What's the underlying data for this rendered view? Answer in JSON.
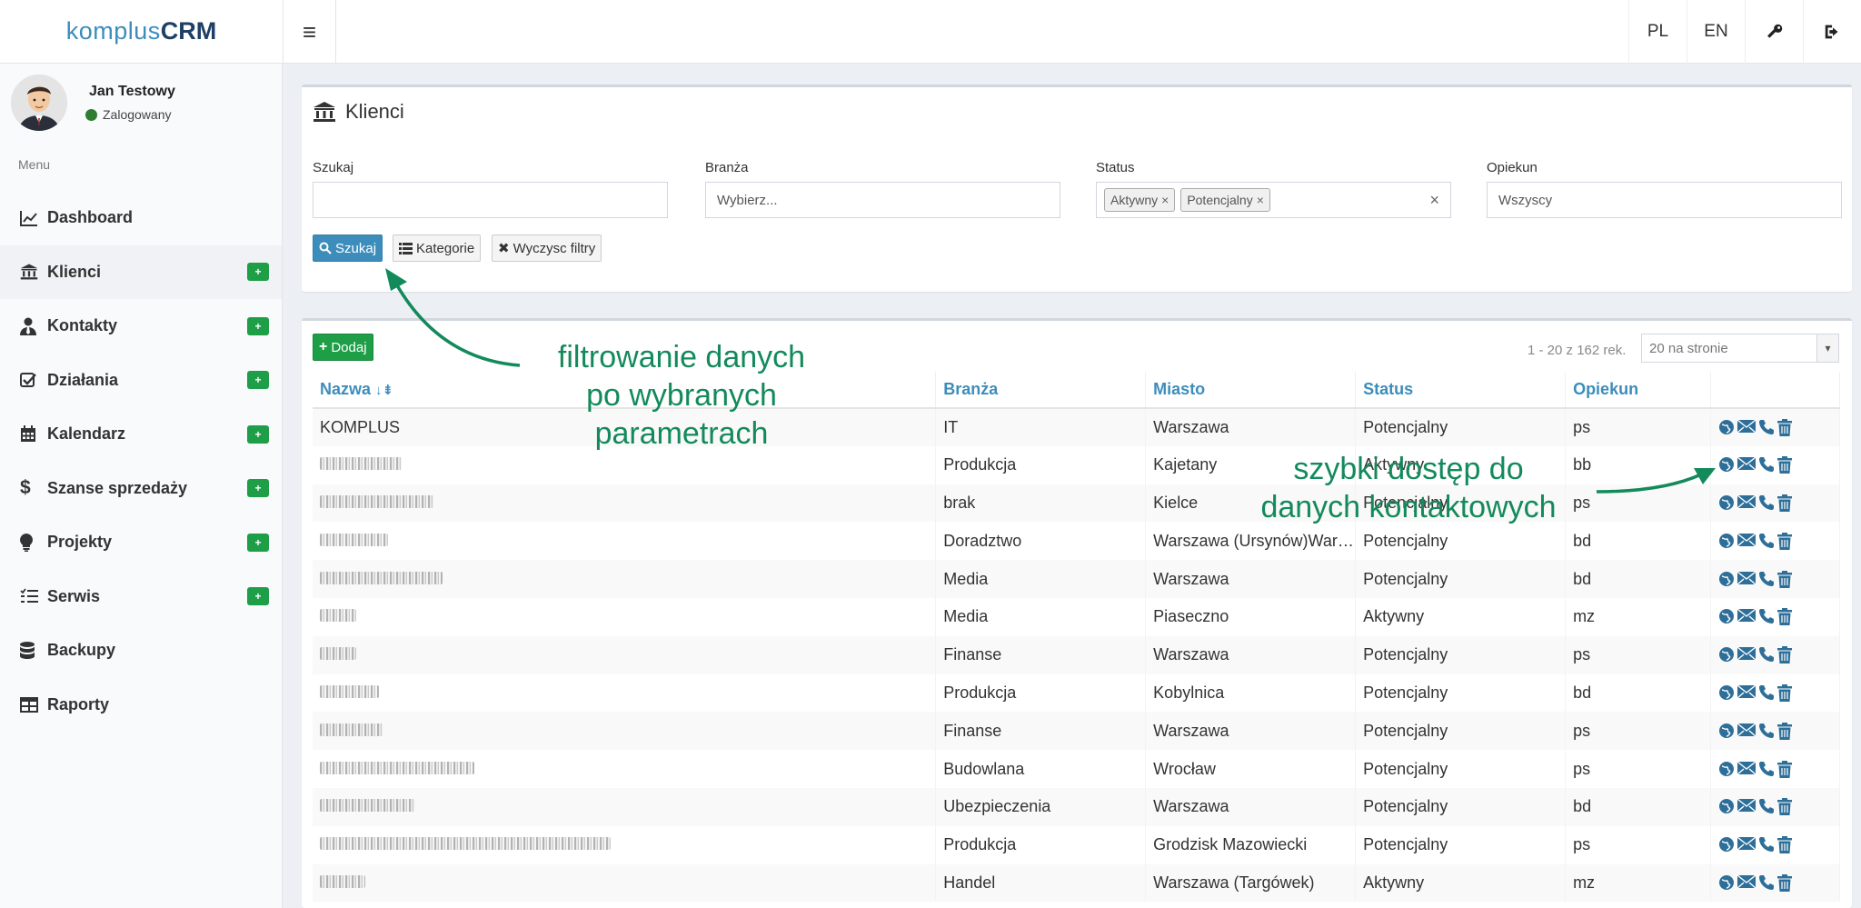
{
  "app": {
    "logo_light": "komplus",
    "logo_bold": "CRM"
  },
  "topnav": {
    "lang_pl": "PL",
    "lang_en": "EN"
  },
  "user": {
    "name": "Jan Testowy",
    "status": "Zalogowany"
  },
  "sidebar": {
    "menu_header": "Menu",
    "items": [
      {
        "label": "Dashboard",
        "icon": "chart-line-icon",
        "badge": false
      },
      {
        "label": "Klienci",
        "icon": "bank-icon",
        "badge": true,
        "active": true
      },
      {
        "label": "Kontakty",
        "icon": "user-tie-icon",
        "badge": true
      },
      {
        "label": "Działania",
        "icon": "checkbox-icon",
        "badge": true
      },
      {
        "label": "Kalendarz",
        "icon": "calendar-icon",
        "badge": true
      },
      {
        "label": "Szanse sprzedaży",
        "icon": "dollar-icon",
        "badge": true
      },
      {
        "label": "Projekty",
        "icon": "lightbulb-icon",
        "badge": true
      },
      {
        "label": "Serwis",
        "icon": "list-check-icon",
        "badge": true
      },
      {
        "label": "Backupy",
        "icon": "database-icon",
        "badge": false
      },
      {
        "label": "Raporty",
        "icon": "table-icon",
        "badge": false
      }
    ],
    "badge_symbol": "+"
  },
  "filters": {
    "title": "Klienci",
    "search_label": "Szukaj",
    "search_value": "",
    "branza_label": "Branża",
    "branza_placeholder": "Wybierz...",
    "status_label": "Status",
    "status_tags": [
      "Aktywny",
      "Potencjalny"
    ],
    "opiekun_label": "Opiekun",
    "opiekun_value": "Wszyscy",
    "btn_search": "Szukaj",
    "btn_categories": "Kategorie",
    "btn_clear": "Wyczysc filtry"
  },
  "list": {
    "btn_add": "Dodaj",
    "pager_info": "1 - 20 z 162 rek.",
    "per_page": "20 na stronie",
    "columns": [
      "Nazwa",
      "Branża",
      "Miasto",
      "Status",
      "Opiekun"
    ],
    "rows": [
      {
        "name": "KOMPLUS",
        "branza": "IT",
        "miasto": "Warszawa",
        "status": "Potencjalny",
        "opiekun": "ps"
      },
      {
        "name": "",
        "blur_w": 90,
        "branza": "Produkcja",
        "miasto": "Kajetany",
        "status": "Aktywny",
        "opiekun": "bb"
      },
      {
        "name": "",
        "blur_w": 125,
        "branza": "brak",
        "miasto": "Kielce",
        "status": "Potencjalny",
        "opiekun": "ps"
      },
      {
        "name": "",
        "blur_w": 75,
        "branza": "Doradztwo",
        "miasto": "Warszawa (Ursynów)War…",
        "status": "Potencjalny",
        "opiekun": "bd"
      },
      {
        "name": "",
        "blur_w": 135,
        "branza": "Media",
        "miasto": "Warszawa",
        "status": "Potencjalny",
        "opiekun": "bd"
      },
      {
        "name": "",
        "blur_w": 40,
        "branza": "Media",
        "miasto": "Piaseczno",
        "status": "Aktywny",
        "opiekun": "mz"
      },
      {
        "name": "",
        "blur_w": 40,
        "branza": "Finanse",
        "miasto": "Warszawa",
        "status": "Potencjalny",
        "opiekun": "ps"
      },
      {
        "name": "",
        "blur_w": 65,
        "branza": "Produkcja",
        "miasto": "Kobylnica",
        "status": "Potencjalny",
        "opiekun": "bd"
      },
      {
        "name": "",
        "blur_w": 70,
        "branza": "Finanse",
        "miasto": "Warszawa",
        "status": "Potencjalny",
        "opiekun": "ps"
      },
      {
        "name": "",
        "blur_w": 170,
        "branza": "Budowlana",
        "miasto": "Wrocław",
        "status": "Potencjalny",
        "opiekun": "ps"
      },
      {
        "name": "",
        "blur_w": 105,
        "branza": "Ubezpieczenia",
        "miasto": "Warszawa",
        "status": "Potencjalny",
        "opiekun": "bd"
      },
      {
        "name": "",
        "blur_w": 320,
        "branza": "Produkcja",
        "miasto": "Grodzisk Mazowiecki",
        "status": "Potencjalny",
        "opiekun": "ps"
      },
      {
        "name": "",
        "blur_w": 50,
        "branza": "Handel",
        "miasto": "Warszawa (Targówek)",
        "status": "Aktywny",
        "opiekun": "mz"
      }
    ]
  },
  "annotations": {
    "filter_note": [
      "filtrowanie danych",
      "po wybranych",
      "parametrach"
    ],
    "contact_note": [
      "szybki dostęp do",
      "danych kontaktowych"
    ],
    "color": "#138a5b"
  },
  "colors": {
    "accent": "#3c8dbc",
    "success": "#1e9e46"
  }
}
